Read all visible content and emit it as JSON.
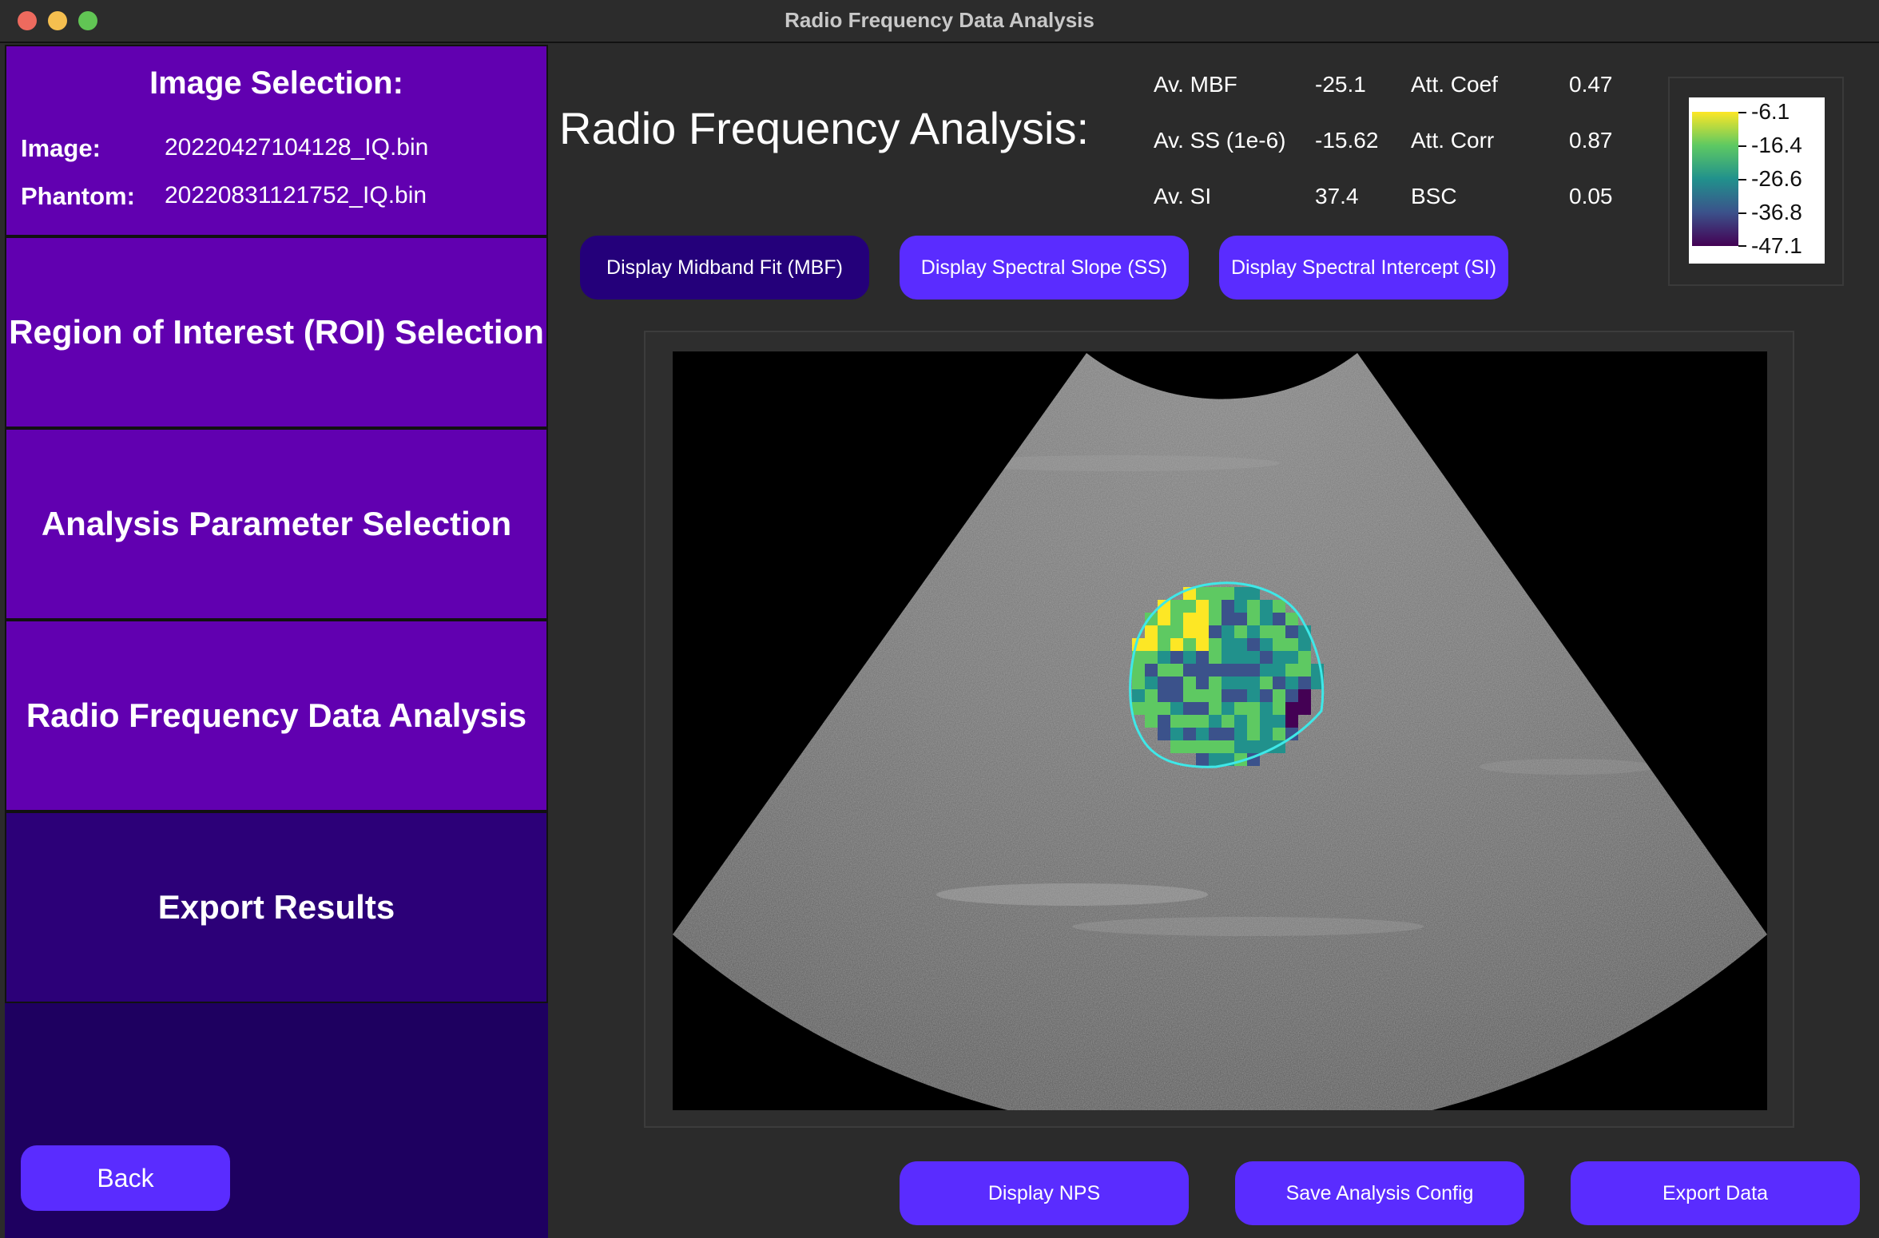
{
  "window": {
    "title": "Radio Frequency Data Analysis"
  },
  "sidebar": {
    "image_selection": {
      "heading": "Image Selection:",
      "image_label": "Image:",
      "image_value": "20220427104128_IQ.bin",
      "phantom_label": "Phantom:",
      "phantom_value": "20220831121752_IQ.bin"
    },
    "roi": "Region of Interest (ROI) Selection",
    "params": "Analysis Parameter Selection",
    "rf": "Radio Frequency Data Analysis",
    "export": "Export Results",
    "back": "Back"
  },
  "main": {
    "title": "Radio Frequency Analysis:",
    "stats": [
      {
        "label": "Av.  MBF",
        "value": "-25.1",
        "label2": "Att. Coef",
        "value2": "0.47"
      },
      {
        "label": "Av.  SS (1e-6)",
        "value": "-15.62",
        "label2": "Att. Corr",
        "value2": "0.87"
      },
      {
        "label": "Av.  SI",
        "value": "37.4",
        "label2": "BSC",
        "value2": "0.05"
      }
    ],
    "buttons": {
      "mbf": "Display Midband Fit (MBF)",
      "ss": "Display Spectral Slope (SS)",
      "si": "Display Spectral Intercept (SI)",
      "nps": "Display NPS",
      "save": "Save Analysis Config",
      "export": "Export Data"
    },
    "colorbar": {
      "labels": [
        "-6.1",
        "-16.4",
        "-26.6",
        "-36.8",
        "-47.1"
      ],
      "colors": [
        "#fde725",
        "#5ec962",
        "#21918c",
        "#3b528b",
        "#440154"
      ]
    },
    "roi_color": "#3ee8e8"
  }
}
